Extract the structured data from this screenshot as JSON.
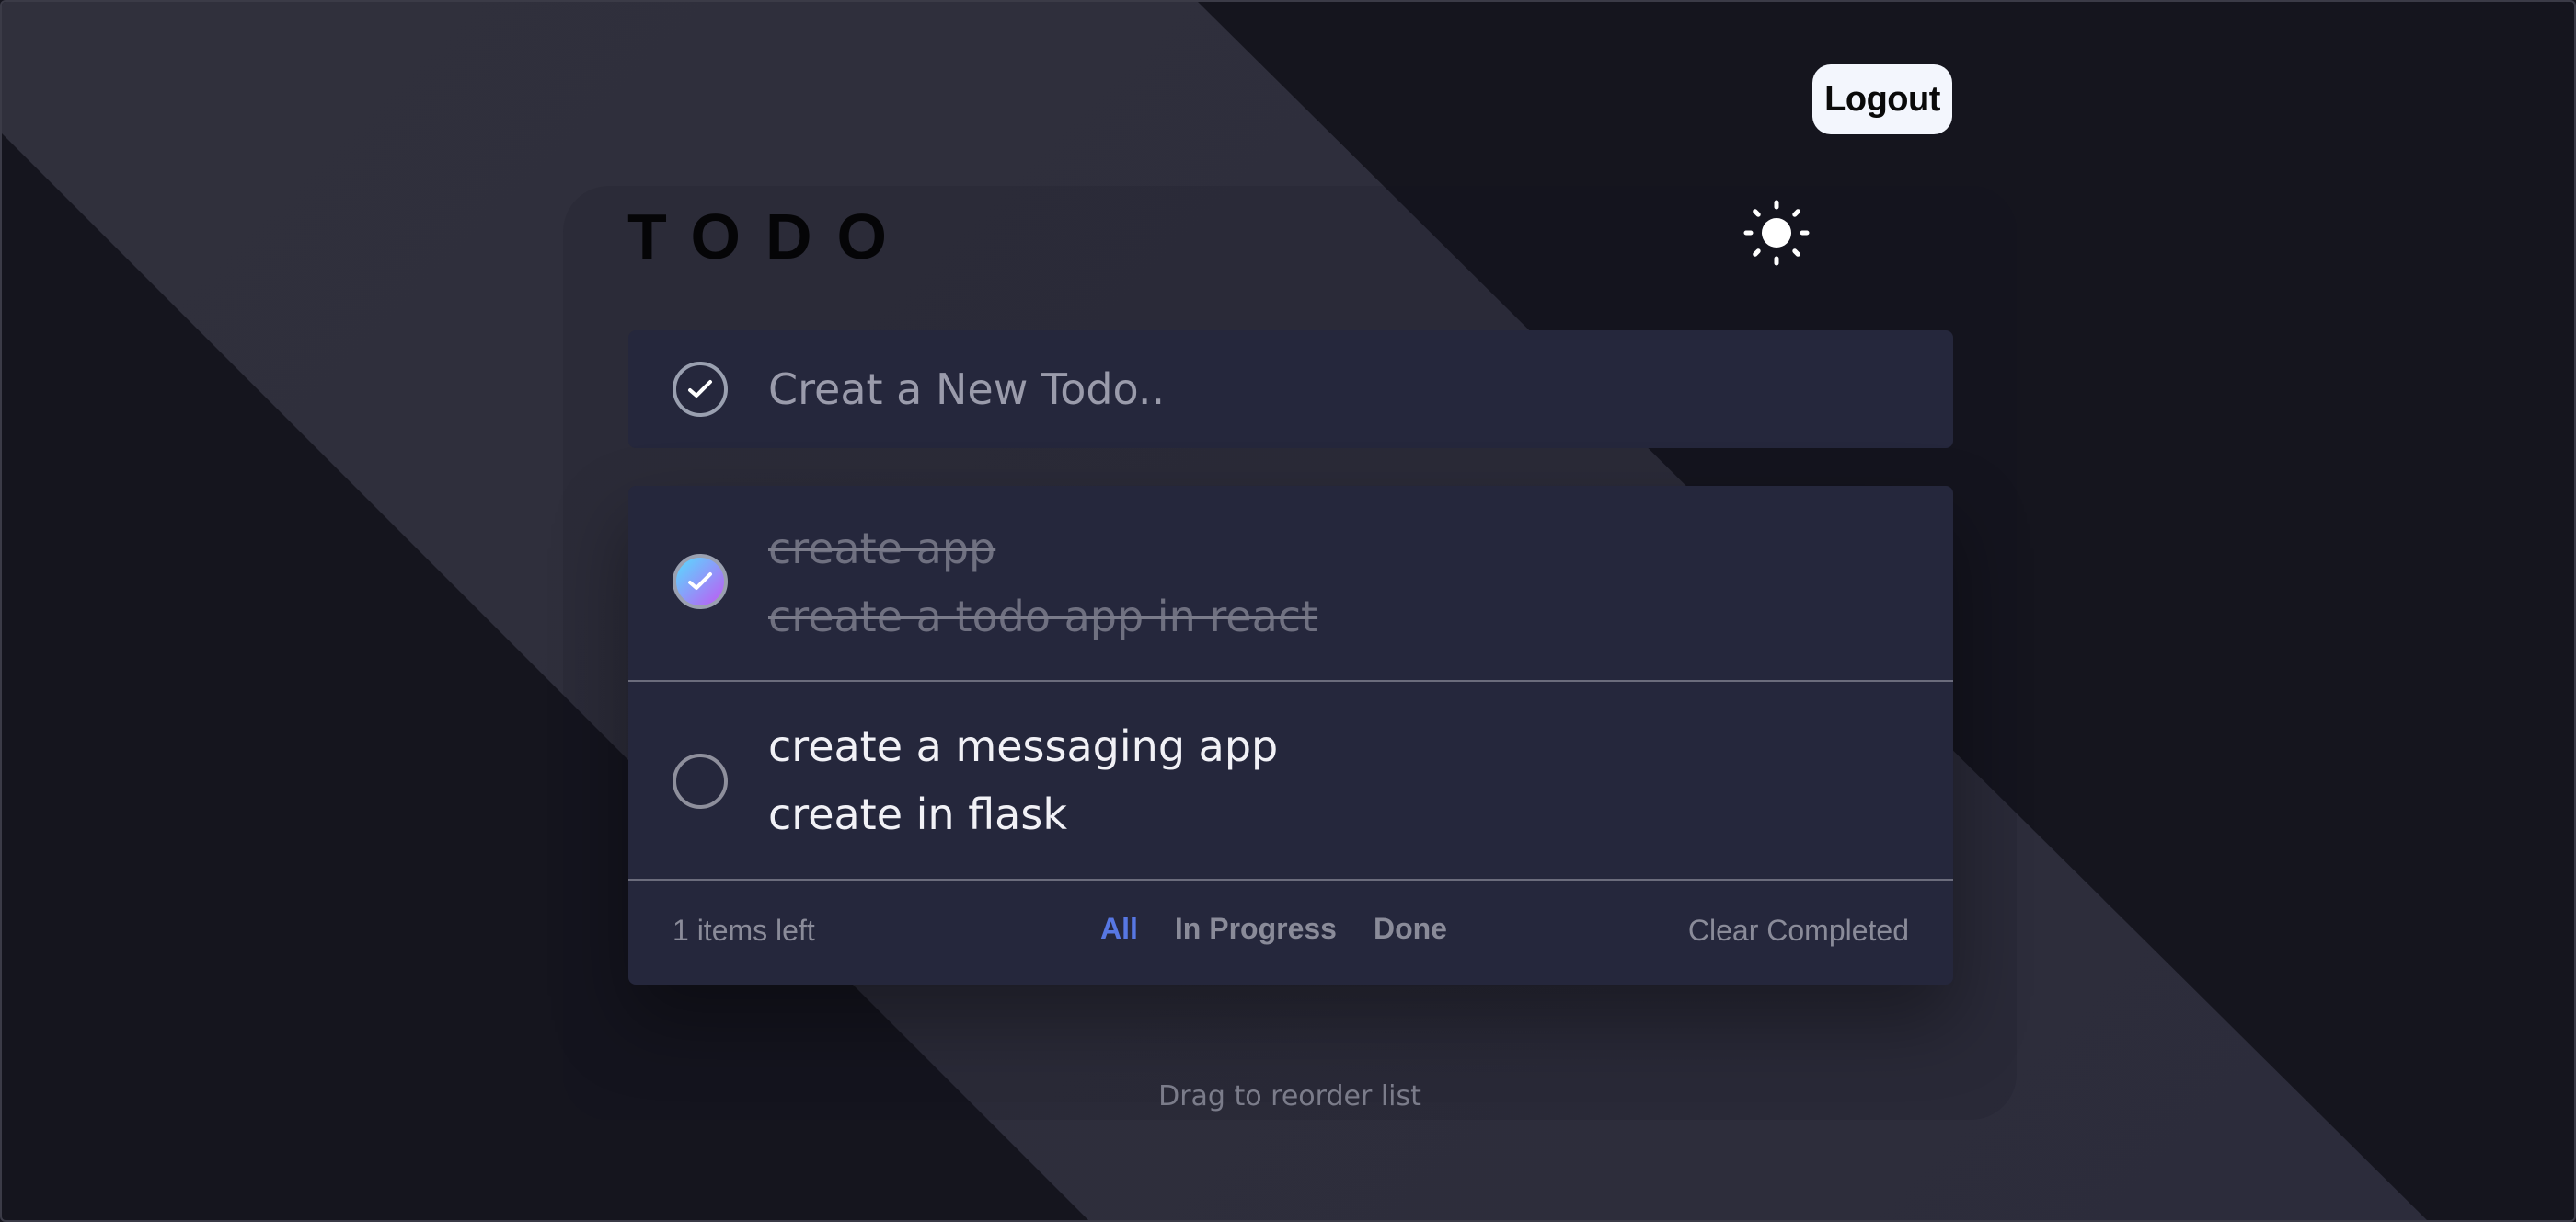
{
  "header": {
    "logout_label": "Logout",
    "title": "TODO",
    "theme_icon": "sun-icon"
  },
  "new_todo": {
    "placeholder": "Creat a New Todo..",
    "value": ""
  },
  "todos": [
    {
      "title": "create app",
      "description": "create a todo app in react",
      "completed": true
    },
    {
      "title": "create a messaging app",
      "description": "create in flask",
      "completed": false
    }
  ],
  "footer": {
    "items_left": "1 items left",
    "filters": [
      "All",
      "In Progress",
      "Done"
    ],
    "active_filter": "All",
    "clear_completed": "Clear Completed"
  },
  "hint": "Drag to reorder list",
  "colors": {
    "accent": "#5777e3",
    "check_gradient_start": "#57ddff",
    "check_gradient_end": "#c058f3",
    "card_bg": "#25273c"
  }
}
